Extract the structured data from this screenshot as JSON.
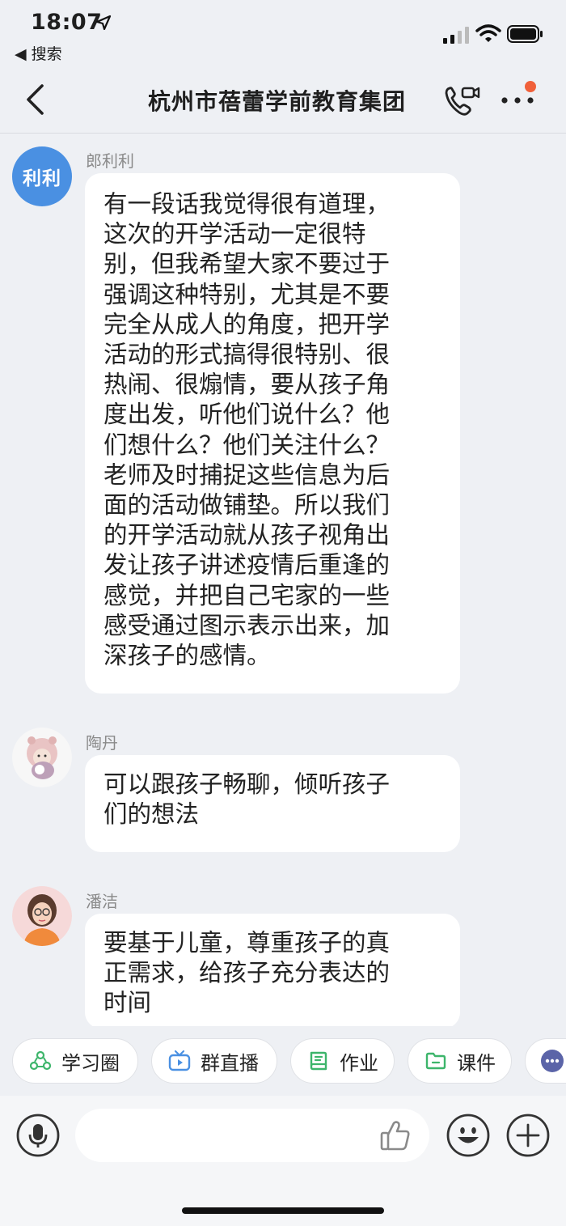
{
  "status_bar": {
    "time": "18:07",
    "back_app_label": "◀ 搜索"
  },
  "header": {
    "title": "杭州市蓓蕾学前教育集团"
  },
  "messages": [
    {
      "sender": "郎利利",
      "avatar_text": "利利",
      "lines": [
        "有一段话我觉得很有道理，",
        "这次的开学活动一定很特",
        "别，但我希望大家不要过于",
        "强调这种特别，尤其是不要",
        "完全从成人的角度，把开学",
        "活动的形式搞得很特别、很",
        "热闹、很煽情，要从孩子角",
        "度出发，听他们说什么？他",
        "们想什么？他们关注什么？",
        "老师及时捕捉这些信息为后",
        "面的活动做铺垫。所以我们",
        "的开学活动就从孩子视角出",
        "发让孩子讲述疫情后重逢的",
        "感觉，并把自己宅家的一些",
        "感受通过图示表示出来，加",
        "深孩子的感情。"
      ]
    },
    {
      "sender": "陶丹",
      "lines": [
        "可以跟孩子畅聊，倾听孩子",
        "们的想法"
      ]
    },
    {
      "sender": "潘洁",
      "lines": [
        "要基于儿童，尊重孩子的真",
        "正需求，给孩子充分表达的",
        "时间"
      ]
    }
  ],
  "toolbar": {
    "chips": [
      {
        "label": "学习圈",
        "icon": "study-circle-icon"
      },
      {
        "label": "群直播",
        "icon": "live-tv-icon"
      },
      {
        "label": "作业",
        "icon": "homework-book-icon"
      },
      {
        "label": "课件",
        "icon": "folder-icon"
      }
    ]
  },
  "colors": {
    "accent_blue": "#4a90e2",
    "green": "#3db56b",
    "badge_orange": "#f0603a",
    "background": "#eef0f4"
  }
}
